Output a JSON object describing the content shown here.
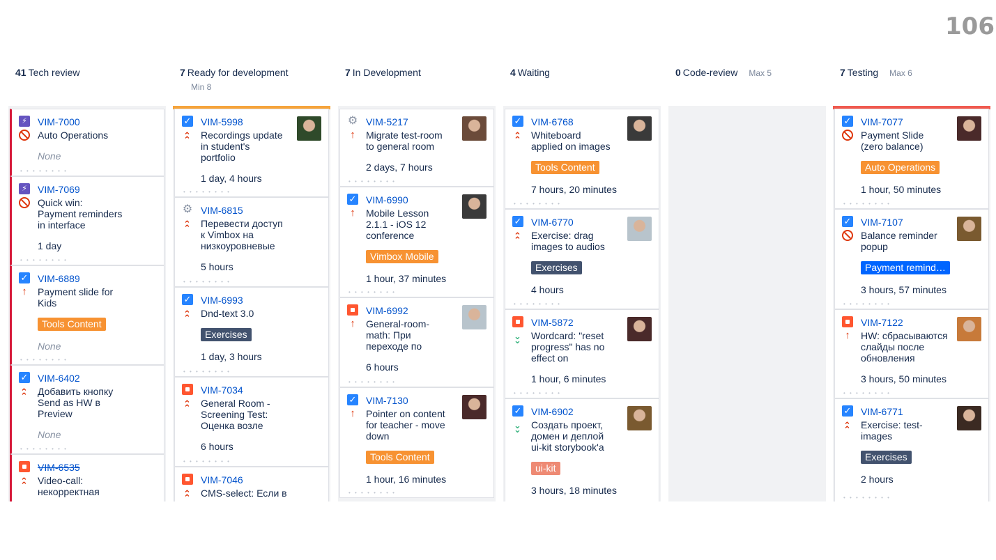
{
  "slide_number": "106",
  "columns": [
    {
      "count": "41",
      "name": "Tech review",
      "limit": "",
      "sub": ""
    },
    {
      "count": "7",
      "name": "Ready for development",
      "limit": "",
      "sub": "Min 8"
    },
    {
      "count": "7",
      "name": "In Development",
      "limit": "",
      "sub": ""
    },
    {
      "count": "4",
      "name": "Waiting",
      "limit": "",
      "sub": ""
    },
    {
      "count": "0",
      "name": "Code-review",
      "limit": "Max 5",
      "sub": ""
    },
    {
      "count": "7",
      "name": "Testing",
      "limit": "Max 6",
      "sub": ""
    }
  ],
  "colors": {
    "orange_label": "#f79232",
    "dark_label": "#42526e",
    "blue_label": "#0065ff",
    "salmon_label": "#ee8a74",
    "flag_red": "#d61a3a",
    "bar_orange": "#f6a43b",
    "bar_red": "#f05a4f"
  },
  "cards": {
    "c0": [
      {
        "key": "VIM-7000",
        "summary": "Auto Operations",
        "type_icon": "epic-icon",
        "priority_icon": "blocker-icon",
        "est": "None"
      },
      {
        "key": "VIM-7069",
        "summary": "Quick win:\nPayment reminders\nin interface",
        "type_icon": "epic-icon",
        "priority_icon": "blocker-icon",
        "est": "1 day"
      },
      {
        "key": "VIM-6889",
        "summary": "Payment slide for\nKids",
        "type_icon": "task-icon",
        "priority_icon": "priority-up-icon",
        "label": "Tools Content",
        "est": "None"
      },
      {
        "key": "VIM-6402",
        "summary": "Добавить кнопку\nSend as HW в\nPreview",
        "type_icon": "task-icon",
        "priority_icon": "priority-high-icon",
        "est": "None"
      },
      {
        "key": "VIM-6535",
        "summary": "Video-call:\nнекорректная",
        "type_icon": "bug-icon",
        "priority_icon": "priority-high-icon"
      }
    ],
    "c1": [
      {
        "key": "VIM-5998",
        "summary": "Recordings update\nin student's\nportfolio",
        "type_icon": "task-icon",
        "priority_icon": "priority-high-icon",
        "est": "1 day, 4 hours"
      },
      {
        "key": "VIM-6815",
        "summary": "Перевести доступ\nк Vimbox на\nнизкоуровневые",
        "type_icon": "gear-icon",
        "priority_icon": "priority-high-icon",
        "est": "5 hours"
      },
      {
        "key": "VIM-6993",
        "summary": "Dnd-text 3.0",
        "type_icon": "task-icon",
        "priority_icon": "priority-high-icon",
        "label": "Exercises",
        "est": "1 day, 3 hours"
      },
      {
        "key": "VIM-7034",
        "summary": "General Room -\nScreening Test:\nОценка возле",
        "type_icon": "bug-icon",
        "priority_icon": "priority-high-icon",
        "est": "6 hours"
      },
      {
        "key": "VIM-7046",
        "summary": "CMS-select: Если в",
        "type_icon": "bug-icon",
        "priority_icon": "priority-high-icon"
      }
    ],
    "c2": [
      {
        "key": "VIM-5217",
        "summary": "Migrate test-room\nto general room",
        "type_icon": "gear-icon",
        "priority_icon": "priority-up-icon",
        "est": "2 days, 7 hours"
      },
      {
        "key": "VIM-6990",
        "summary": "Mobile Lesson\n2.1.1 - iOS 12\nconference",
        "type_icon": "task-icon",
        "priority_icon": "priority-up-icon",
        "label": "Vimbox Mobile",
        "est": "1 hour, 37 minutes"
      },
      {
        "key": "VIM-6992",
        "summary": "General-room-\nmath: При\nпереходе по",
        "type_icon": "bug-icon",
        "priority_icon": "priority-up-icon",
        "est": "6 hours"
      },
      {
        "key": "VIM-7130",
        "summary": "Pointer on content\nfor teacher - move\ndown",
        "type_icon": "task-icon",
        "priority_icon": "priority-up-icon",
        "label": "Tools Content",
        "est": "1 hour, 16 minutes"
      }
    ],
    "c3": [
      {
        "key": "VIM-6768",
        "summary": "Whiteboard\napplied on images",
        "type_icon": "task-icon",
        "priority_icon": "priority-high-icon",
        "label": "Tools Content",
        "est": "7 hours, 20 minutes"
      },
      {
        "key": "VIM-6770",
        "summary": "Exercise: drag\nimages to audios",
        "type_icon": "task-icon",
        "priority_icon": "priority-high-icon",
        "label": "Exercises",
        "est": "4 hours"
      },
      {
        "key": "VIM-5872",
        "summary": "Wordcard: \"reset\nprogress\" has no\neffect on",
        "type_icon": "bug-icon",
        "priority_icon": "priority-low-icon",
        "est": "1 hour, 6 minutes"
      },
      {
        "key": "VIM-6902",
        "summary": "Создать проект,\nдомен и деплой\nui-kit storybook'а",
        "type_icon": "task-icon",
        "priority_icon": "priority-low-icon",
        "label": "ui-kit",
        "est": "3 hours, 18 minutes"
      }
    ],
    "c5": [
      {
        "key": "VIM-7077",
        "summary": "Payment Slide\n(zero balance)",
        "type_icon": "task-icon",
        "priority_icon": "blocker-icon",
        "label": "Auto Operations",
        "est": "1 hour, 50 minutes"
      },
      {
        "key": "VIM-7107",
        "summary": "Balance reminder\npopup",
        "type_icon": "task-icon",
        "priority_icon": "blocker-icon",
        "label": "Payment remind…",
        "est": "3 hours, 57 minutes"
      },
      {
        "key": "VIM-7122",
        "summary": "HW: сбрасываются\nслайды после\nобновления",
        "type_icon": "bug-icon",
        "priority_icon": "priority-up-icon",
        "est": "3 hours, 50 minutes"
      },
      {
        "key": "VIM-6771",
        "summary": "Exercise: test-\nimages",
        "type_icon": "task-icon",
        "priority_icon": "priority-high-icon",
        "label": "Exercises",
        "est": "2 hours"
      }
    ]
  }
}
